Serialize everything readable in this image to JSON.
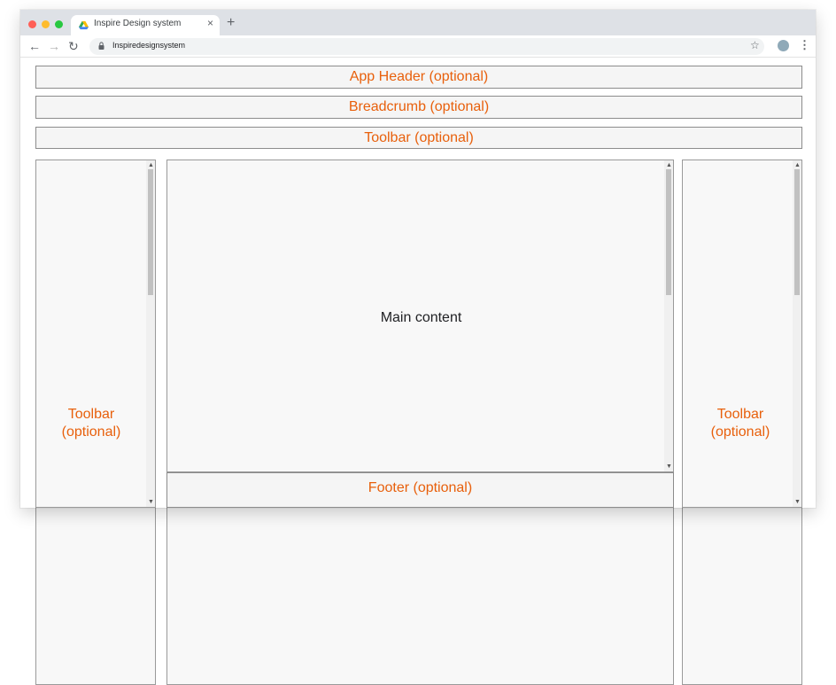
{
  "browser": {
    "tab_title": "Inspire Design system",
    "tab_close": "×",
    "new_tab": "+",
    "back": "←",
    "forward": "→",
    "reload": "↻",
    "url": "Inspiredesignsystem",
    "star": "☆",
    "menu": "⋮",
    "traffic_lights": [
      "#ff5f57",
      "#febc2e",
      "#28c840"
    ]
  },
  "layout": {
    "app_header": "App Header (optional)",
    "breadcrumb": "Breadcrumb (optional)",
    "toolbar_top": "Toolbar (optional)",
    "main_content": "Main content",
    "footer": "Footer (optional)",
    "left_toolbar_line1": "Toolbar",
    "left_toolbar_line2": "(optional)",
    "right_toolbar_line1": "Toolbar",
    "right_toolbar_line2": "(optional)"
  },
  "colors": {
    "accent": "#e8600c",
    "border": "#8c8c8c",
    "panel_bg": "#f8f8f8"
  }
}
